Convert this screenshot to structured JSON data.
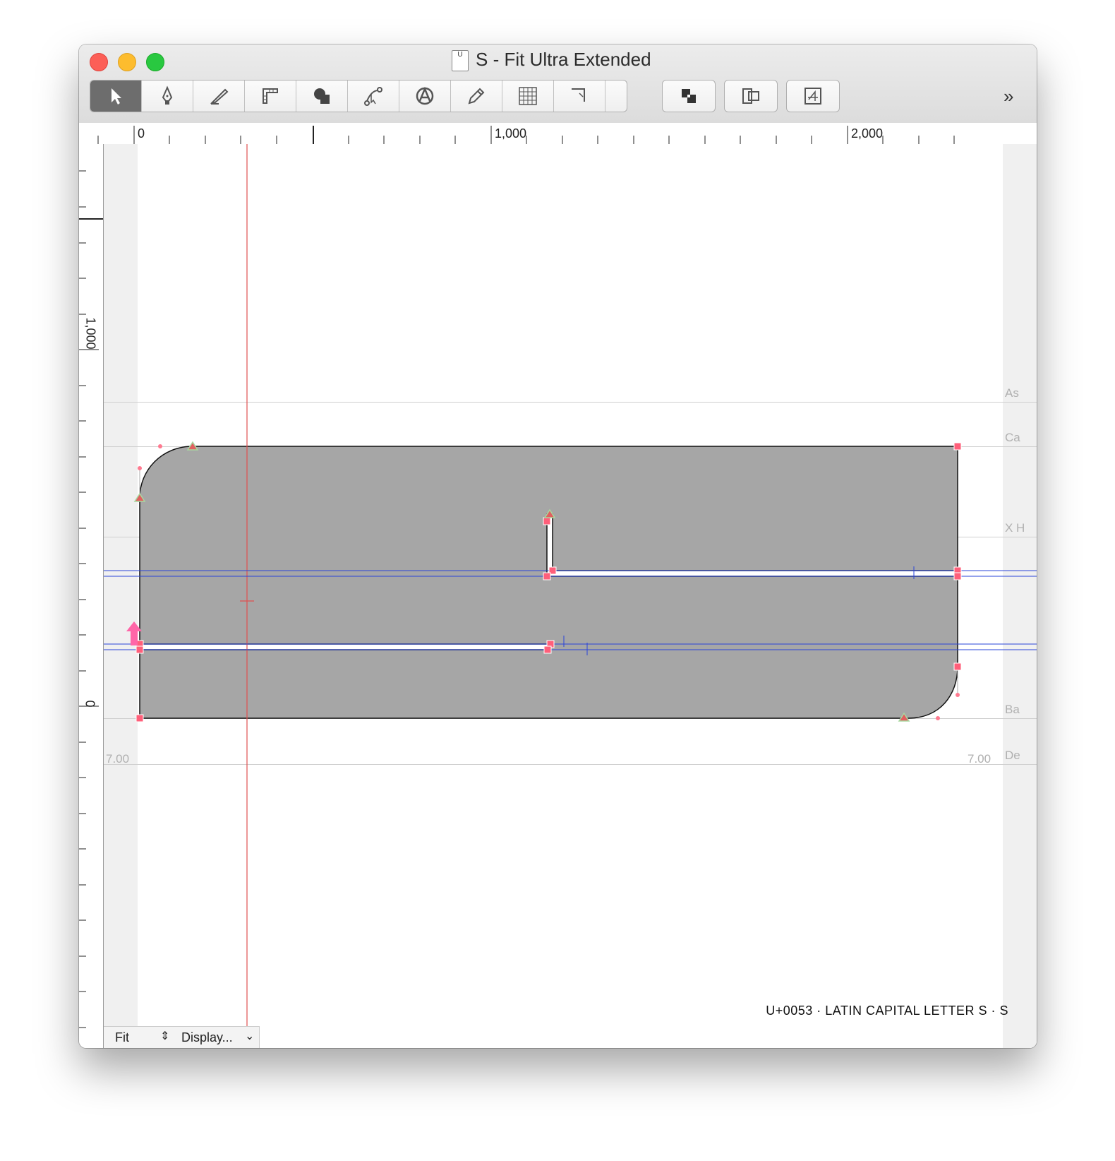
{
  "window": {
    "title": "S - Fit Ultra Extended",
    "doc_icon_label": "U",
    "overflow_label": "»"
  },
  "toolbar": {
    "tools": [
      {
        "name": "selection-tool",
        "icon": "arrow-icon",
        "selected": true
      },
      {
        "name": "pen-tool",
        "icon": "pen-icon"
      },
      {
        "name": "knife-tool",
        "icon": "knife-icon"
      },
      {
        "name": "measure-tool",
        "icon": "ruler-icon"
      },
      {
        "name": "shapes-tool",
        "icon": "shapes-icon"
      },
      {
        "name": "nodes-tool",
        "icon": "nodes-icon"
      },
      {
        "name": "anchor-tool",
        "icon": "anchor-icon"
      },
      {
        "name": "pencil-tool",
        "icon": "pencil-icon"
      },
      {
        "name": "grid-tool",
        "icon": "grid-icon"
      },
      {
        "name": "corner-tool",
        "icon": "corner-icon"
      }
    ]
  },
  "ruler": {
    "h_labels": [
      "0",
      "1,000",
      "2,000"
    ],
    "v_labels": [
      "1,000",
      "0"
    ]
  },
  "metrics": {
    "ascender": "As",
    "cap_height": "Ca",
    "x_height": "X H",
    "baseline": "Ba",
    "descender": "De",
    "left_sidebearing": "7.00",
    "right_sidebearing": "7.00"
  },
  "glyph": {
    "unicode_label": "U+0053 · LATIN CAPITAL LETTER S · S"
  },
  "bottombar": {
    "zoom": "Fit",
    "zoom_arrows": "⇕",
    "display": "Display...",
    "display_chevron": "⌄"
  },
  "colors": {
    "glyph_fill": "#a6a6a6",
    "node": "#ff5f7a",
    "guide_red": "#e05050",
    "guide_blue": "#2a44d8"
  }
}
